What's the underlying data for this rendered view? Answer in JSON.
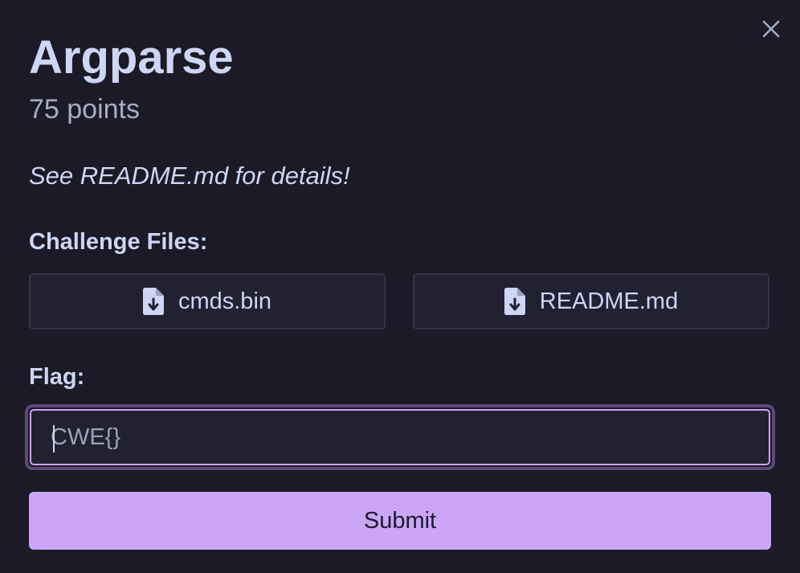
{
  "challenge": {
    "title": "Argparse",
    "points": "75 points",
    "description": "See README.md for details!"
  },
  "files": {
    "label": "Challenge Files:",
    "items": [
      {
        "name": "cmds.bin",
        "icon": "file-download-icon"
      },
      {
        "name": "README.md",
        "icon": "file-download-icon"
      }
    ]
  },
  "flag": {
    "label": "Flag:",
    "value": "CWE{}"
  },
  "actions": {
    "submit_label": "Submit",
    "close_icon": "close-icon"
  },
  "colors": {
    "background": "#1b1a26",
    "accent": "#cba6f7",
    "text": "#cdd6f4",
    "muted": "#a6adc8"
  }
}
